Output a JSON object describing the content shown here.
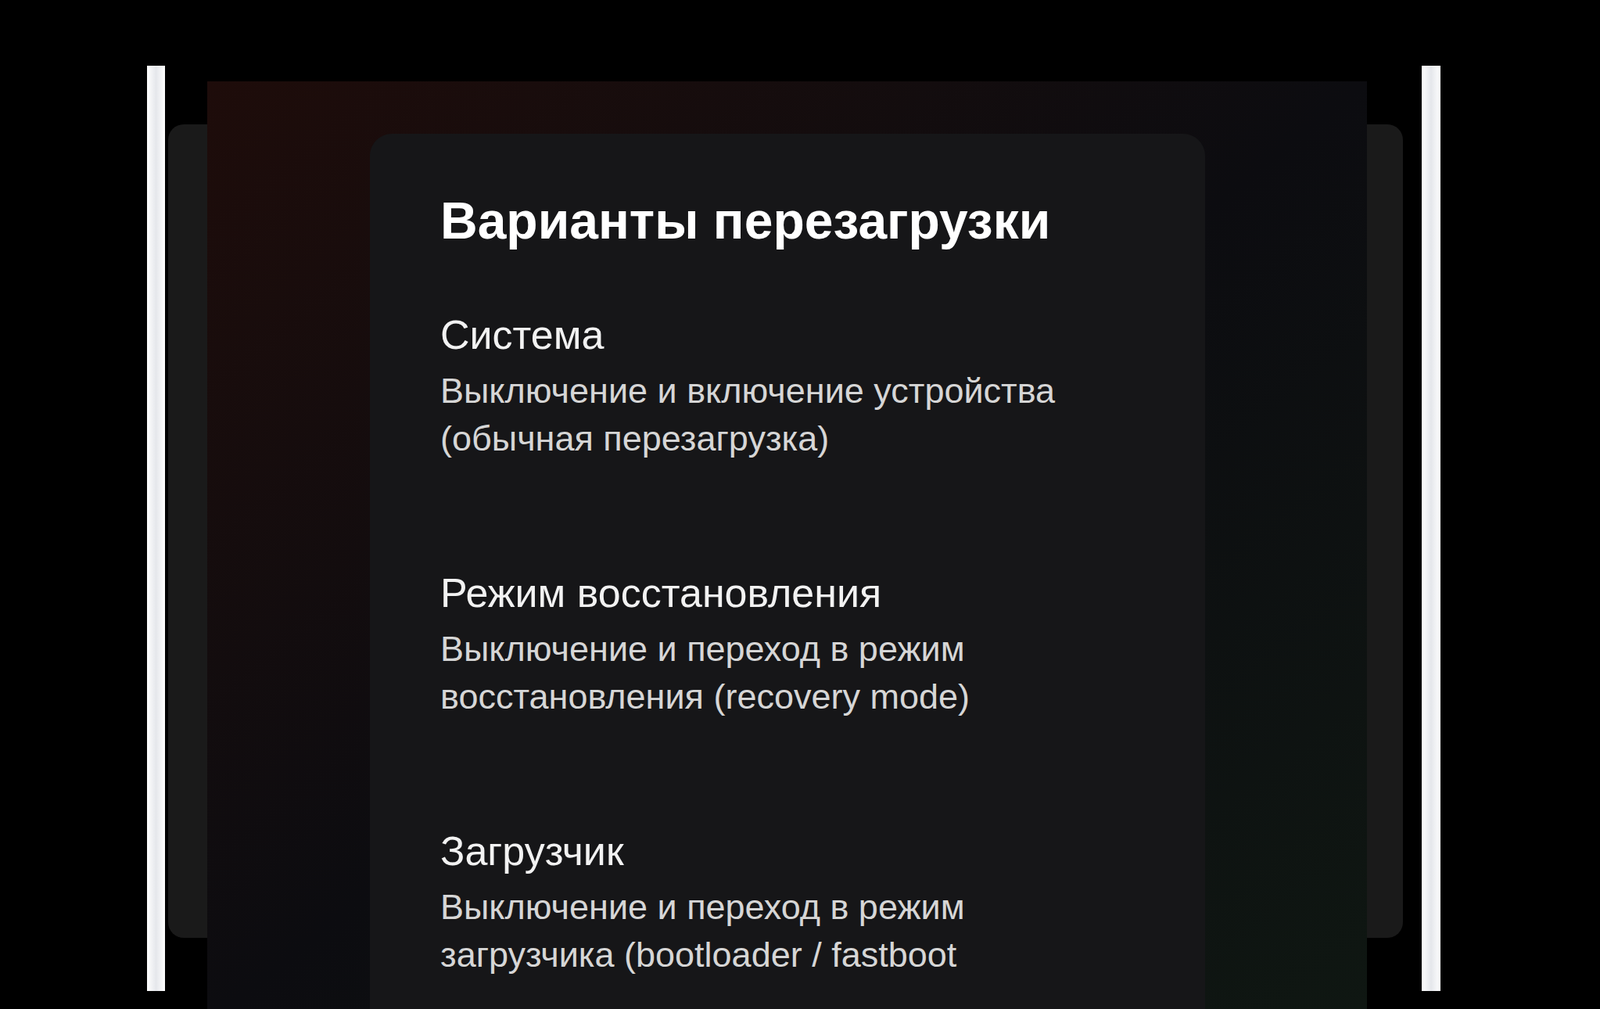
{
  "dialog": {
    "title": "Варианты перезагрузки",
    "options": [
      {
        "title": "Система",
        "description": "Выключение и включение устройства (обычная перезагрузка)"
      },
      {
        "title": "Режим восстановления",
        "description": "Выключение и переход в режим восстановления (recovery mode)"
      },
      {
        "title": "Загрузчик",
        "description": "Выключение и переход в режим загрузчика (bootloader / fastboot"
      }
    ]
  }
}
